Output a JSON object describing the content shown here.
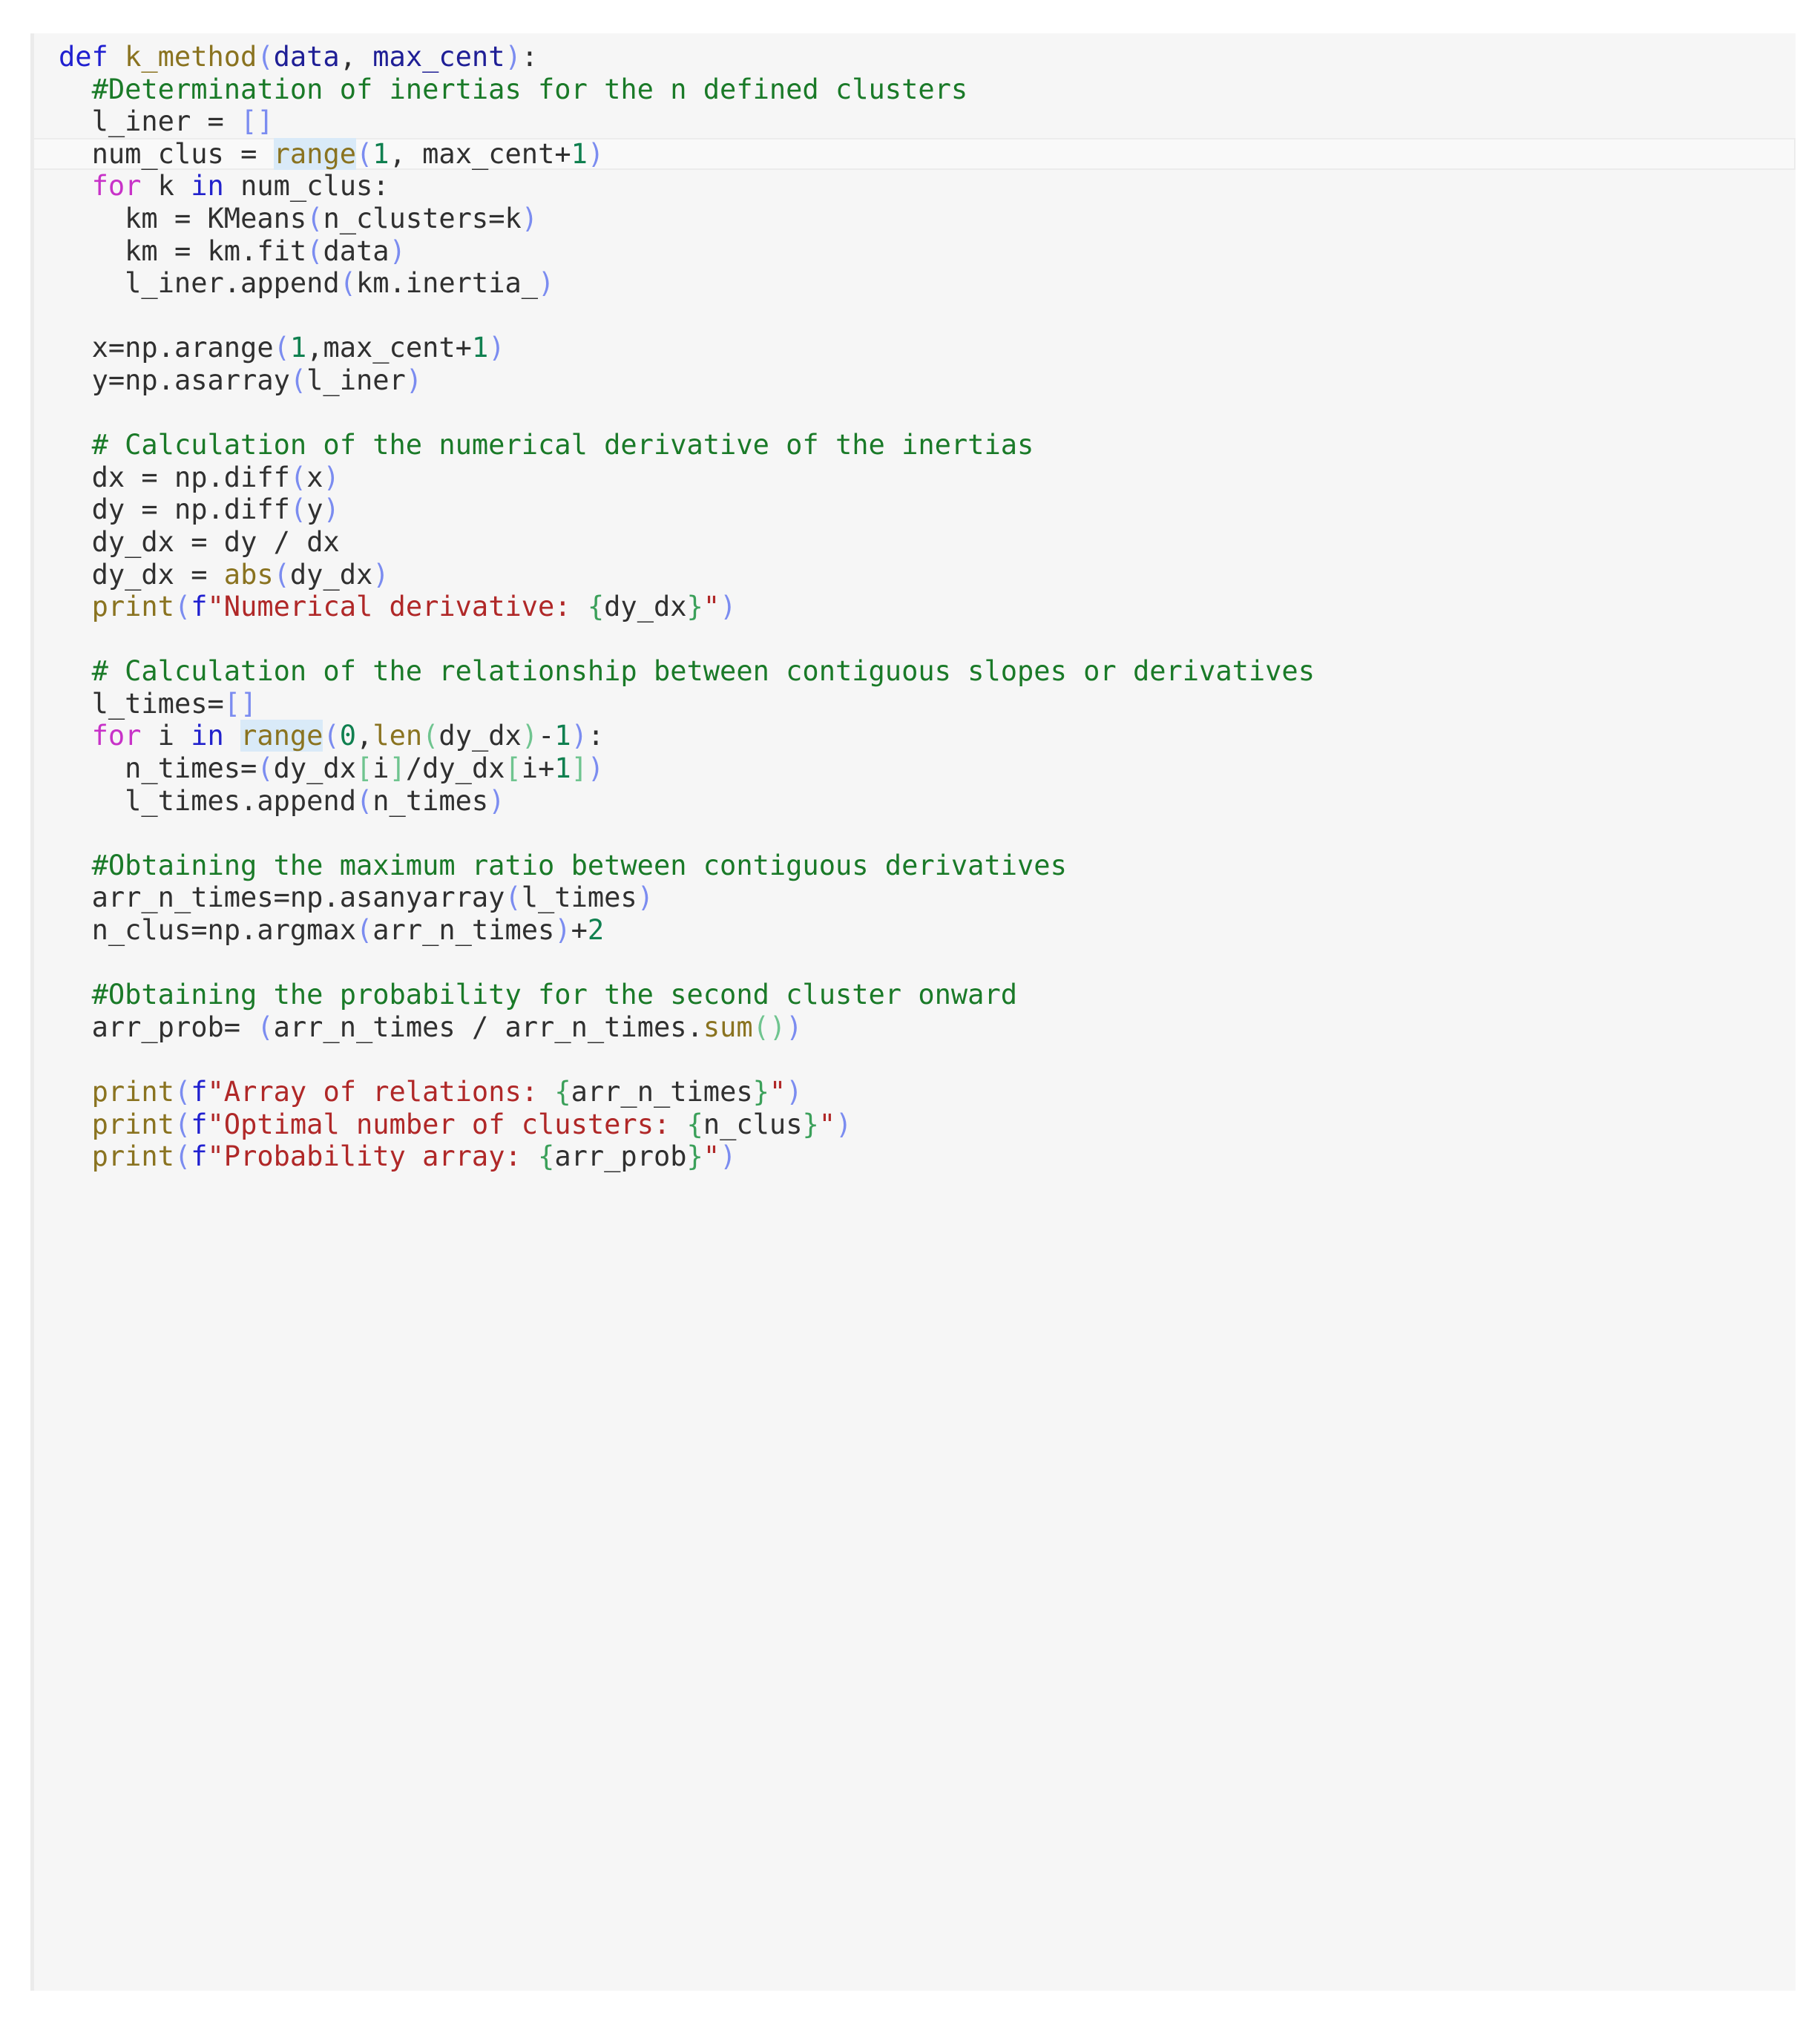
{
  "editor": {
    "language": "python",
    "function_name": "k_method",
    "background_color": "#f6f6f6",
    "page_background": "#ffffff",
    "gutter_color": "#ebebeb",
    "highlighted_line_number": 4,
    "highlighted_token": "range",
    "token_highlight_color": "#d9eaf8",
    "syntax_colors": {
      "keyword": "#2020d0",
      "keyword_for": "#c832c8",
      "keyword_in": "#2222cc",
      "function": "#8a7320",
      "parameter": "#1f1f96",
      "comment": "#1a7a28",
      "string": "#b02828",
      "number": "#108050",
      "bracket_level_1": "#7b8cf0",
      "bracket_level_2": "#6fc48f",
      "identifier": "#303030",
      "fstring_brace": "#3ba05a"
    }
  },
  "code": {
    "lines": [
      "def k_method(data, max_cent):",
      "  #Determination of inertias for the n defined clusters",
      "  l_iner = []",
      "  num_clus = range(1, max_cent+1)",
      "  for k in num_clus:",
      "    km = KMeans(n_clusters=k)",
      "    km = km.fit(data)",
      "    l_iner.append(km.inertia_)",
      "",
      "  x=np.arange(1,max_cent+1)",
      "  y=np.asarray(l_iner)",
      "",
      "  # Calculation of the numerical derivative of the inertias",
      "  dx = np.diff(x)",
      "  dy = np.diff(y)",
      "  dy_dx = dy / dx",
      "  dy_dx = abs(dy_dx)",
      "  print(f\"Numerical derivative: {dy_dx}\")",
      "",
      "  # Calculation of the relationship between contiguous slopes or derivatives",
      "  l_times=[]",
      "  for i in range(0,len(dy_dx)-1):",
      "    n_times=(dy_dx[i]/dy_dx[i+1])",
      "    l_times.append(n_times)",
      "",
      "  #Obtaining the maximum ratio between contiguous derivatives",
      "  arr_n_times=np.asanyarray(l_times)",
      "  n_clus=np.argmax(arr_n_times)+2",
      "",
      "  #Obtaining the probability for the second cluster onward",
      "  arr_prob= (arr_n_times / arr_n_times.sum())",
      "",
      "  print(f\"Array of relations: {arr_n_times}\")",
      "  print(f\"Optimal number of clusters: {n_clus}\")",
      "  print(f\"Probability array: {arr_prob}\")"
    ],
    "comments": [
      "#Determination of inertias for the n defined clusters",
      "# Calculation of the numerical derivative of the inertias",
      "# Calculation of the relationship between contiguous slopes or derivatives",
      "#Obtaining the maximum ratio between contiguous derivatives",
      "#Obtaining the probability for the second cluster onward"
    ],
    "strings": [
      "Numerical derivative: {dy_dx}",
      "Array of relations: {arr_n_times}",
      "Optimal number of clusters: {n_clus}",
      "Probability array: {arr_prob}"
    ],
    "builtins": [
      "range",
      "abs",
      "len",
      "sum",
      "print"
    ],
    "keywords": [
      "def",
      "for",
      "in"
    ],
    "parameters": [
      "data",
      "max_cent"
    ]
  }
}
